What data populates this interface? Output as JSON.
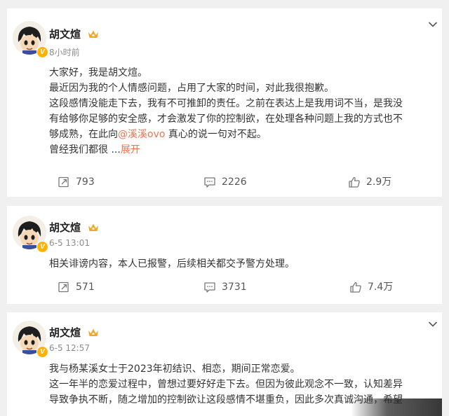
{
  "posts": [
    {
      "author": "胡文煊",
      "time": "8小时前",
      "lines": [
        "大家好，我是胡文煊。",
        "最近因为我的个人情感问题，占用了大家的时间，对此我很抱歉。",
        "这段感情没能走下去，我有不可推卸的责任。之前在表达上是我用词不当，是我没",
        "有给够你足够的安全感，才会激发了你的控制欲，在处理各种问题上我的方式也不"
      ],
      "line5_before": "够成熟，在此向",
      "mention": "@溪溪ovo",
      "line5_after": " 真心的说一句对不起。",
      "line6": "曾经我们都很",
      "ellipsis": "...",
      "expand_label": "展开",
      "reposts": "793",
      "comments": "2226",
      "likes": "2.9万"
    },
    {
      "author": "胡文煊",
      "time": "6-5 13:01",
      "text": "相关诽谤内容，本人已报警，后续相关都交予警方处理。",
      "reposts": "571",
      "comments": "3731",
      "likes": "7.4万"
    },
    {
      "author": "胡文煊",
      "time": "6-5 12:57",
      "lines": [
        "我与杨某溪女士于2023年初结识、相恋，期间正常恋爱。",
        "这一年半的恋爱过程中，曾想过要好好走下去。但因为彼此观念不一致，认知差异",
        "导致争执不断，随之增加的控制欲让这段感情不堪重负，因此多次真诚沟通，希望"
      ]
    }
  ],
  "icons": {
    "repost": "repost-icon",
    "comment": "comment-icon",
    "like": "like-icon",
    "more": "chevron-down-icon",
    "crown": "crown-icon",
    "verified": "verified-badge-icon"
  },
  "colors": {
    "link": "#eb7350",
    "crown": "#f5a623",
    "verified": "#ffb300"
  }
}
